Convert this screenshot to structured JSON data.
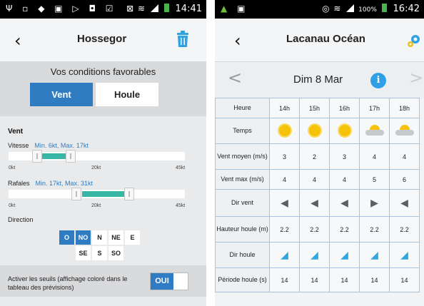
{
  "left": {
    "status": {
      "icons": "Ψ ▫ ◆ ▣ ▷ ◘ ☑",
      "right_icons": "⊠ ✕",
      "time": "14:41"
    },
    "title": "Hossegor",
    "conditions_title": "Vos conditions favorables",
    "tabs": [
      {
        "label": "Vent",
        "active": true
      },
      {
        "label": "Houle",
        "active": false
      }
    ],
    "section": "Vent",
    "vitesse": {
      "label": "Vitesse",
      "range": "Min. 6kt, Max. 17kt",
      "min": 6,
      "max": 17,
      "scale_max": 45,
      "ticks": [
        "0kt",
        "20kt",
        "45kt"
      ]
    },
    "rafales": {
      "label": "Rafales",
      "range": "Min. 17kt, Max. 31kt",
      "min": 17,
      "max": 31,
      "scale_max": 45,
      "ticks": [
        "0kt",
        "20kt",
        "45kt"
      ]
    },
    "direction_label": "Direction",
    "directions_row1": [
      {
        "label": "O",
        "on": true
      },
      {
        "label": "NO",
        "on": true
      },
      {
        "label": "N",
        "on": false
      },
      {
        "label": "NE",
        "on": false
      },
      {
        "label": "E",
        "on": false
      }
    ],
    "directions_row2": [
      {
        "label": "SE",
        "on": false
      },
      {
        "label": "S",
        "on": false
      },
      {
        "label": "SO",
        "on": false
      }
    ],
    "seuils_text": "Activer les seuils (affichage coloré dans le tableau des prévisions)",
    "toggle": "OUI",
    "accent": "#2f7cc3",
    "fill_color": "#39b7a6"
  },
  "right": {
    "status": {
      "battery": "100%",
      "time": "16:42"
    },
    "title": "Lacanau Océan",
    "date": "Dim 8 Mar",
    "prev": "<",
    "next": ">",
    "rows": {
      "hours": {
        "label": "Heure",
        "values": [
          "14h",
          "15h",
          "16h",
          "17h",
          "18h"
        ]
      },
      "weather": {
        "label": "Temps",
        "values": [
          "sun",
          "sun",
          "sun",
          "sun-cloud",
          "sun-cloud"
        ]
      },
      "vent_moyen": {
        "label": "Vent moyen (m/s)",
        "values": [
          "3",
          "2",
          "3",
          "4",
          "4"
        ]
      },
      "vent_max": {
        "label": "Vent max (m/s)",
        "values": [
          "4",
          "4",
          "4",
          "5",
          "6"
        ]
      },
      "dir_vent": {
        "label": "Dir vent",
        "values": [
          "arrow-sw",
          "arrow-sw",
          "arrow-sw",
          "arrow-e",
          "arrow-sw"
        ]
      },
      "hauteur": {
        "label": "Hauteur houle (m)",
        "values": [
          "2.2",
          "2.2",
          "2.2",
          "2.2",
          "2.2"
        ]
      },
      "dir_houle": {
        "label": "Dir houle",
        "values": [
          "arrow-ne",
          "arrow-ne",
          "arrow-ne",
          "arrow-ne",
          "arrow-ne"
        ]
      },
      "periode": {
        "label": "Période houle (s)",
        "values": [
          "14",
          "14",
          "14",
          "14",
          "14"
        ]
      }
    }
  }
}
